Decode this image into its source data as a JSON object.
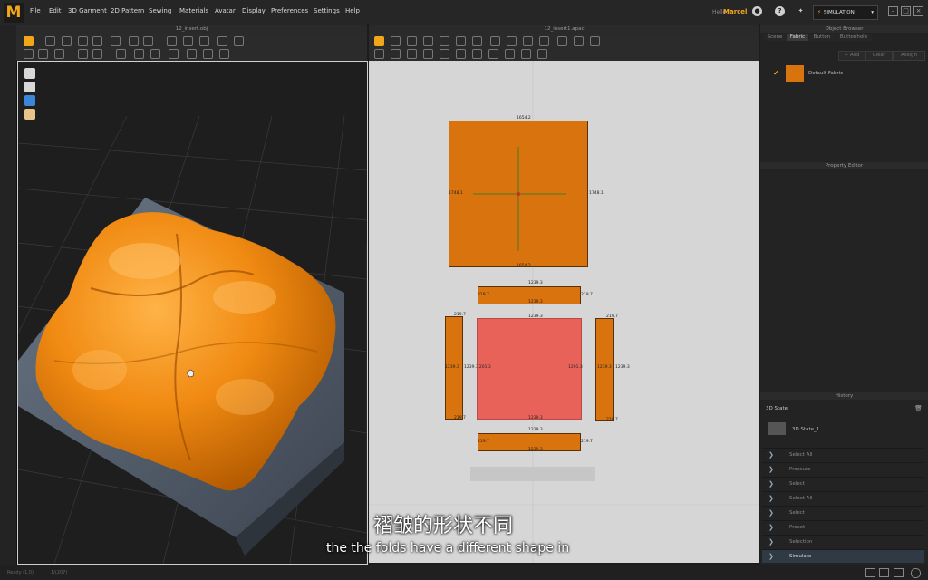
{
  "app": {
    "logo": "M"
  },
  "menu": [
    "File",
    "Edit",
    "3D Garment",
    "2D Pattern",
    "Sewing",
    "Materials",
    "Avatar",
    "Display",
    "Preferences",
    "Settings",
    "Help"
  ],
  "user": {
    "greeting": "Hello,",
    "name": "Marcel"
  },
  "mode_button": "SIMULATION",
  "panel3d": {
    "title": "12_insert.obj"
  },
  "panel2d": {
    "title": "12_insert1.apac"
  },
  "pattern": {
    "top_square": {
      "top": "1654.2",
      "bottom": "1654.2",
      "left": "1748.1",
      "right": "1748.1"
    },
    "strip_top": {
      "width": "1239.3",
      "width_inner": "1239.3",
      "left": "219.7",
      "right": "219.7"
    },
    "strip_left": {
      "height": "1239.3",
      "inner": "1239.3",
      "top": "219.7",
      "bottom": "219.7"
    },
    "center": {
      "top": "1239.3",
      "bottom": "1239.3",
      "left": "1201.3",
      "right": "1201.3"
    },
    "strip_right": {
      "height": "1239.3",
      "inner": "1239.3",
      "top": "219.7",
      "bottom": "219.7"
    },
    "strip_bottom": {
      "width": "1239.3",
      "width_inner": "1239.3",
      "left": "219.7",
      "right": "219.7"
    }
  },
  "object_browser": {
    "title": "Object Browser",
    "tabs": [
      "Scene",
      "Fabric",
      "Button",
      "Buttonhole"
    ],
    "active_tab": "Fabric",
    "buttons": {
      "add": "+ Add",
      "clear": "Clear",
      "assign": "Assign"
    },
    "fabric_name": "Default Fabric",
    "fabric_color": "#d9730d"
  },
  "property_editor": {
    "title": "Property Editor"
  },
  "history": {
    "title": "History",
    "state_header": "3D State",
    "state_item": "3D State_1",
    "rows": [
      "Select All",
      "Pressure",
      "Select",
      "Select All",
      "Select",
      "Preset",
      "Selection",
      "Simulate"
    ]
  },
  "status": {
    "left": "Ready  (1,0)",
    "mid": "1/(207)"
  },
  "subtitles": {
    "zh": "褶皱的形状不同",
    "en": "the the folds have a different shape in"
  },
  "colors": {
    "accent": "#f2a71b",
    "fabric": "#d9730d",
    "selected_piece": "#e8625a"
  }
}
